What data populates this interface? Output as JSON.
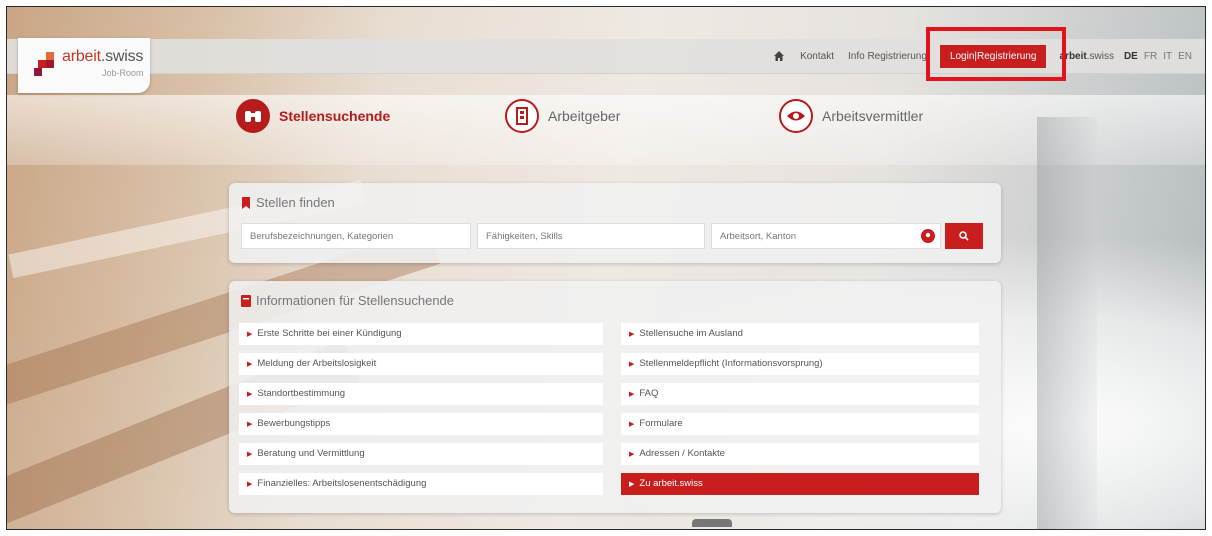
{
  "brand": {
    "logo_prefix": "arbeit",
    "logo_suffix": ".swiss",
    "logo_sub": "Job-Room",
    "accent_color": "#c81e1e"
  },
  "nav": {
    "home_icon": "home-icon",
    "kontakt": "Kontakt",
    "info": "Info Registrierung",
    "login": "Login|Registrierung",
    "brand_link_bold": "arbeit",
    "brand_link_rest": ".swiss",
    "languages": [
      "DE",
      "FR",
      "IT",
      "EN"
    ],
    "active_language": "DE"
  },
  "roles": [
    {
      "label": "Stellensuchende",
      "icon": "binoculars-icon",
      "active": true
    },
    {
      "label": "Arbeitgeber",
      "icon": "building-icon",
      "active": false
    },
    {
      "label": "Arbeitsvermittler",
      "icon": "eye-icon",
      "active": false
    }
  ],
  "search": {
    "title": "Stellen finden",
    "job_placeholder": "Berufsbezeichnungen, Kategorien",
    "skills_placeholder": "Fähigkeiten, Skills",
    "location_placeholder": "Arbeitsort, Kanton"
  },
  "info": {
    "title": "Informationen für Stellensuchende",
    "left_links": [
      "Erste Schritte bei einer Kündigung",
      "Meldung der Arbeitslosigkeit",
      "Standortbestimmung",
      "Bewerbungstipps",
      "Beratung und Vermittlung",
      "Finanzielles: Arbeitslosenentschädigung"
    ],
    "right_links": [
      "Stellensuche im Ausland",
      "Stellenmeldepflicht (Informationsvorsprung)",
      "FAQ",
      "Formulare",
      "Adressen / Kontakte",
      "Zu arbeit.swiss"
    ]
  }
}
